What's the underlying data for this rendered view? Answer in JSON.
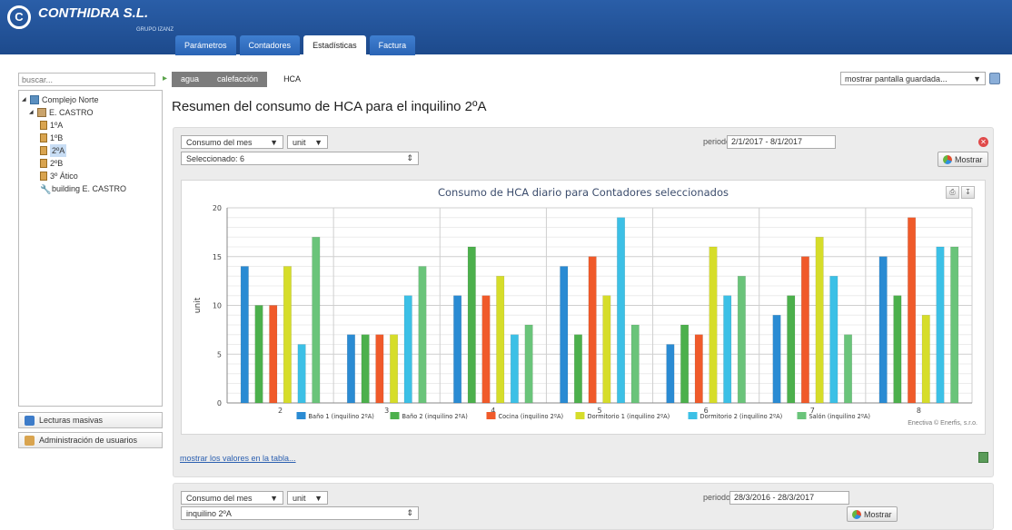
{
  "header": {
    "logo_text": "CONTHIDRA S.L.",
    "logo_sub": "GRUPO IZANZ",
    "tabs": [
      "Parámetros",
      "Contadores",
      "Estadísticas",
      "Factura"
    ],
    "active_tab": "Estadísticas"
  },
  "sidebar": {
    "search_placeholder": "buscar...",
    "tree": [
      {
        "label": "Complejo Norte",
        "level": 0,
        "icon": "building-icon"
      },
      {
        "label": "E. CASTRO",
        "level": 1,
        "icon": "house-icon"
      },
      {
        "label": "1ºA",
        "level": 2,
        "icon": "flat-icon"
      },
      {
        "label": "1ºB",
        "level": 2,
        "icon": "flat-icon"
      },
      {
        "label": "2ºA",
        "level": 2,
        "icon": "flat-icon",
        "selected": true
      },
      {
        "label": "2ºB",
        "level": 2,
        "icon": "flat-icon"
      },
      {
        "label": "3º Ático",
        "level": 2,
        "icon": "flat-icon"
      },
      {
        "label": "building E. CASTRO",
        "level": 2,
        "icon": "wrench-icon"
      }
    ],
    "buttons": [
      "Lecturas masivas",
      "Administración de usuarios"
    ]
  },
  "subtabs": [
    "agua",
    "calefacción",
    "HCA"
  ],
  "active_subtab": "HCA",
  "saved_view_select": "mostrar pantalla guardada...",
  "page_title": "Resumen del consumo de HCA para el inquilino 2ºA",
  "panel1": {
    "type_select": "Consumo del mes",
    "unit_select": "unit",
    "filter_select": "Seleccionado: 6",
    "period_label": "periodo",
    "period_value": "2/1/2017 - 8/1/2017",
    "mostrar_label": "Mostrar",
    "table_link": "mostrar los valores en la tabla...",
    "credit": "Enectiva © Enerfis, s.r.o."
  },
  "panel2": {
    "type_select": "Consumo del mes",
    "unit_select": "unit",
    "filter_select": "inquilino 2ºA",
    "period_label": "periodo",
    "period_value": "28/3/2016 - 28/3/2017",
    "mostrar_label": "Mostrar"
  },
  "colors": {
    "header": "#1d4a8c",
    "series": [
      "#2a8bd3",
      "#4cb04c",
      "#f05a2a",
      "#d6dd2a",
      "#3cc0e6",
      "#6ac47a"
    ]
  },
  "chart_data": {
    "type": "bar",
    "title": "Consumo de HCA diario para Contadores seleccionados",
    "ylabel": "unit",
    "xlabel": "",
    "ylim": [
      0,
      20
    ],
    "yticks": [
      0,
      5,
      10,
      15,
      20
    ],
    "categories": [
      "2",
      "3",
      "4",
      "5",
      "6",
      "7",
      "8"
    ],
    "series": [
      {
        "name": "Baño 1 (inquilino 2ºA)",
        "values": [
          14,
          7,
          11,
          14,
          6,
          9,
          15
        ]
      },
      {
        "name": "Baño 2 (inquilino 2ºA)",
        "values": [
          10,
          7,
          16,
          7,
          8,
          11,
          11
        ]
      },
      {
        "name": "Cocina (inquilino 2ºA)",
        "values": [
          10,
          7,
          11,
          15,
          7,
          15,
          19
        ]
      },
      {
        "name": "Dormitorio 1 (inquilino 2ºA)",
        "values": [
          14,
          7,
          13,
          11,
          16,
          17,
          9
        ]
      },
      {
        "name": "Dormitorio 2 (inquilino 2ºA)",
        "values": [
          6,
          11,
          7,
          19,
          11,
          13,
          16
        ]
      },
      {
        "name": "Salón (inquilino 2ºA)",
        "values": [
          17,
          14,
          8,
          8,
          13,
          7,
          16
        ]
      }
    ],
    "grid": true,
    "legend_position": "bottom"
  }
}
